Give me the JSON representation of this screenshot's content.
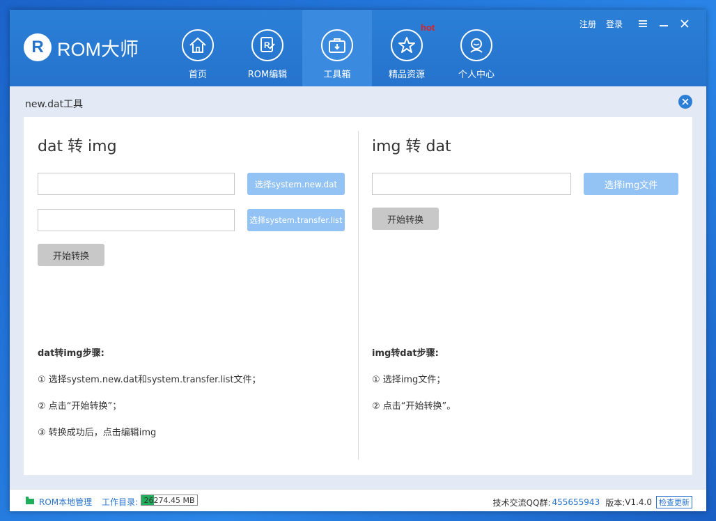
{
  "app": {
    "logo_mark": "R",
    "logo_text": "ROM大师"
  },
  "nav": {
    "items": [
      {
        "label": "首页",
        "icon": "home-icon"
      },
      {
        "label": "ROM编辑",
        "icon": "rom-edit-icon"
      },
      {
        "label": "工具箱",
        "icon": "toolbox-icon"
      },
      {
        "label": "精品资源",
        "icon": "star-icon"
      },
      {
        "label": "个人中心",
        "icon": "user-icon"
      }
    ],
    "active_index": 2,
    "hot_badge": "hot"
  },
  "top_bar": {
    "register": "注册",
    "login": "登录"
  },
  "tool": {
    "title": "new.dat工具"
  },
  "left": {
    "heading": "dat 转 img",
    "input1_value": "",
    "input2_value": "",
    "btn_select_newdat": "选择system.new.dat",
    "btn_select_transfer": "选择system.transfer.list",
    "btn_start": "开始转换",
    "steps_title": "dat转img步骤:",
    "steps": [
      "① 选择system.new.dat和system.transfer.list文件；",
      "② 点击“开始转换”；",
      "③ 转换成功后，点击编辑img"
    ]
  },
  "right": {
    "heading": "img 转 dat",
    "input_value": "",
    "btn_select_img": "选择img文件",
    "btn_start": "开始转换",
    "steps_title": "img转dat步骤:",
    "steps": [
      "① 选择img文件；",
      "② 点击“开始转换”。"
    ]
  },
  "status": {
    "local_mgmt": "ROM本地管理",
    "workdir_label": "工作目录:",
    "disk_text": "26274.45 MB",
    "disk_fill_fraction": 0.22,
    "qq_label": "技术交流QQ群:",
    "qq_number": "455655943",
    "version_label": "版本:",
    "version": "V1.4.0",
    "check_update": "检查更新"
  },
  "colors": {
    "header": "#2573cd",
    "active_tab": "#3a8be0",
    "button_blue": "#93c3f4",
    "button_gray": "#c8c8c8",
    "hot": "#e0201c",
    "disk_fill": "#1fae5a"
  }
}
